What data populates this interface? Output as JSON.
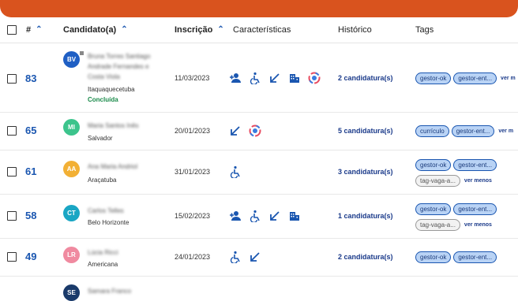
{
  "header": {
    "index_label": "#",
    "candidate_label": "Candidato(a)",
    "date_label": "Inscrição",
    "features_label": "Características",
    "history_label": "Histórico",
    "tags_label": "Tags"
  },
  "rows": [
    {
      "id": "83",
      "initials": "BV",
      "avatar_color": "#1f5fc4",
      "name": "Bruna Torres Santiago Andrade Fernandes e Costa Viola",
      "city": "Itaquaquecetuba",
      "status": "Concluída",
      "date": "11/03/2023",
      "history": "2 candidatura(s)",
      "tags": [
        "gestor-ok",
        "gestor-ent..."
      ],
      "more": "ver m"
    },
    {
      "id": "65",
      "initials": "MI",
      "avatar_color": "#3cc48c",
      "name": "Maria Santos Inês",
      "city": "Salvador",
      "date": "20/01/2023",
      "history": "5 candidatura(s)",
      "tags": [
        "currículo",
        "gestor-ent..."
      ],
      "more": "ver m"
    },
    {
      "id": "61",
      "initials": "AA",
      "avatar_color": "#f2b035",
      "name": "Ana Maria Andriol",
      "city": "Araçatuba",
      "date": "31/01/2023",
      "history": "3 candidatura(s)",
      "tags": [
        "gestor-ok",
        "gestor-ent..."
      ],
      "extra_tag": "tag-vaga-a...",
      "more": "ver menos"
    },
    {
      "id": "58",
      "initials": "CT",
      "avatar_color": "#1aa6c4",
      "name": "Carlos Telles",
      "city": "Belo Horizonte",
      "date": "15/02/2023",
      "history": "1 candidatura(s)",
      "tags": [
        "gestor-ok",
        "gestor-ent..."
      ],
      "extra_tag": "tag-vaga-a...",
      "more": "ver menos"
    },
    {
      "id": "49",
      "initials": "LR",
      "avatar_color": "#f08aa0",
      "name": "Lúcia Ricci",
      "city": "Americana",
      "date": "24/01/2023",
      "history": "2 candidatura(s)",
      "tags": [
        "gestor-ok",
        "gestor-ent..."
      ]
    },
    {
      "id": "",
      "initials": "SE",
      "avatar_color": "#1a3a6a",
      "name": "Samara Franco",
      "city": "",
      "date": "",
      "history": "",
      "tags": []
    }
  ],
  "icons": {
    "add_person": "person-add-icon",
    "accessibility": "accessibility-icon",
    "arrow": "arrow-down-left-icon",
    "company": "building-icon",
    "logo": "circle-logo-icon"
  }
}
